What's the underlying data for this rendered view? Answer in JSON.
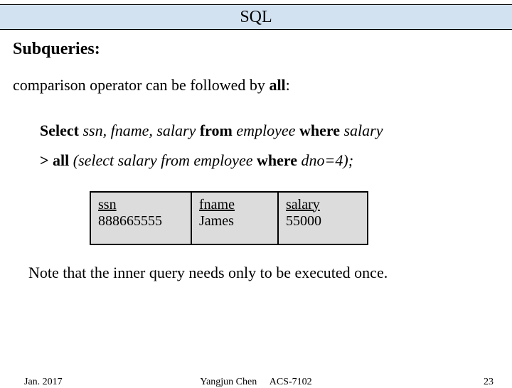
{
  "title": "SQL",
  "heading": "Subqueries:",
  "intro": {
    "pre": "comparison operator can be followed by ",
    "kw": "all",
    "post": ":"
  },
  "query": {
    "line1": {
      "p1": "Select ",
      "p2": "ssn, fname, salary ",
      "p3": "from ",
      "p4": "employee ",
      "p5": "where ",
      "p6": "salary"
    },
    "line2": {
      "p1": "> all ",
      "p2": "(select salary from ",
      "p3": "employee ",
      "p4": "where ",
      "p5": "dno=4);"
    }
  },
  "table": {
    "cols": {
      "ssn": {
        "header": "ssn",
        "value": "888665555"
      },
      "fname": {
        "header": "fname",
        "value": "James"
      },
      "salary": {
        "header": "salary",
        "value": "55000"
      }
    }
  },
  "note": "Note that the inner query needs only to be executed once.",
  "footer": {
    "left": "Jan. 2017",
    "center_name": "Yangjun Chen",
    "center_course": "ACS-7102",
    "right": "23"
  }
}
